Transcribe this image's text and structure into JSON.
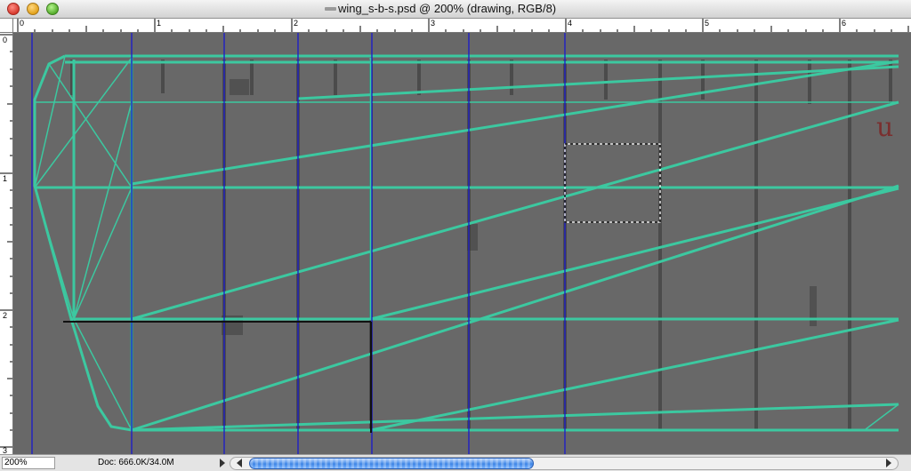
{
  "window": {
    "title": "wing_s-b-s.psd @ 200% (drawing, RGB/8)"
  },
  "rulers": {
    "horizontal_labels": [
      "0",
      "1",
      "2",
      "3",
      "4",
      "5",
      "6"
    ],
    "vertical_labels": [
      "0",
      "1",
      "2",
      "3"
    ]
  },
  "canvas": {
    "background_color": "#686868",
    "wireframe_color": "#3cc8a0",
    "guide_color": "#1a1acc",
    "faint_marking": "u"
  },
  "status": {
    "zoom": "200%",
    "doc": "Doc: 666.0K/34.0M"
  }
}
